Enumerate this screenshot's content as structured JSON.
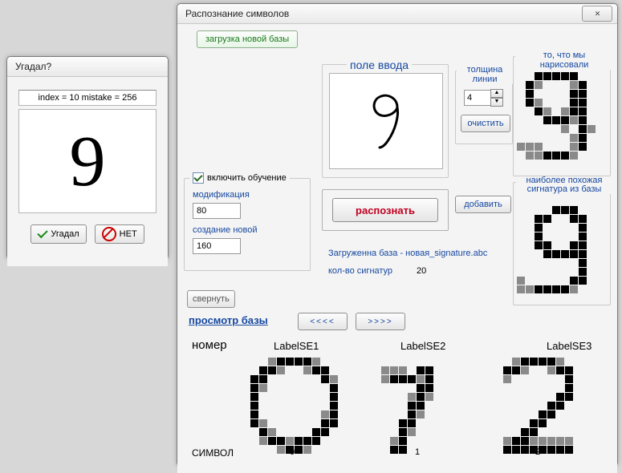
{
  "result": {
    "title": "Угадал?",
    "info": "index = 10  mistake = 256",
    "digit": "9",
    "btn_yes": "Угадал",
    "btn_no": "НЕТ"
  },
  "main": {
    "title": "Распознание символов",
    "tab_load": "загрузка новой базы",
    "input_label": "поле ввода",
    "thickness_label": "толщина линии",
    "thickness_value": "4",
    "btn_clear": "очистить",
    "chk_train": "включить обучение",
    "label_mod": "модификация",
    "val_mod": "80",
    "label_create": "создание новой",
    "val_create": "160",
    "btn_recognize": "распознать",
    "btn_add": "добавить",
    "grp_drawn": "то, что мы нарисовали",
    "grp_best": "наиболее похожая сигнатура из базы",
    "db_loaded": "Загруженна база - новая_signature.abc",
    "db_count_label": "кол-во сигнатур",
    "db_count_value": "20",
    "btn_collapse": "свернуть",
    "browse_title": "просмотр базы",
    "btn_prev": "<<<<",
    "btn_next": ">>>>",
    "col_number": "номер",
    "col_symbol": "СИМВОЛ",
    "labels": [
      "LabelSE1",
      "LabelSE2",
      "LabelSE3"
    ],
    "symbols": [
      "0",
      "1",
      "2"
    ]
  },
  "pixmaps": {
    "drawn_9": [
      "..........",
      "..#####...",
      ".#@...@#..",
      ".#....##..",
      ".#@...##..",
      "..#@.@##..",
      "...###@#..",
      ".....@.#@.",
      "......@#..",
      "@@@...@#..",
      ".@@###@..."
    ],
    "best_9": [
      "..........",
      "....###...",
      "..##..##..",
      "..#....#..",
      "..#....#..",
      "..##..##..",
      "...#####..",
      ".......#..",
      ".......#..",
      "@.....##..",
      "@@####@..."
    ],
    "db0": [
      "...@####@...",
      "..##@..@##..",
      ".##......#@.",
      ".#@.......#.",
      ".#........#.",
      ".#........#.",
      ".#.......@#.",
      ".#@......##.",
      "..#@....##..",
      "..@##@###...",
      "....@##@...."
    ],
    "db1": [
      "............",
      "..@@@.##....",
      "..@###@#....",
      "......##....",
      ".....@#@....",
      ".....##.....",
      ".....#@.....",
      "....##......",
      "....#@......",
      "...@#.......",
      "...##......."
    ],
    "db2": [
      "...@####@...",
      "..##@..@##..",
      "..@......#..",
      ".........#..",
      "........##..",
      ".......##...",
      "......##....",
      ".....##.....",
      "....##......",
      "..@##@@@@@..",
      "..########.."
    ]
  }
}
